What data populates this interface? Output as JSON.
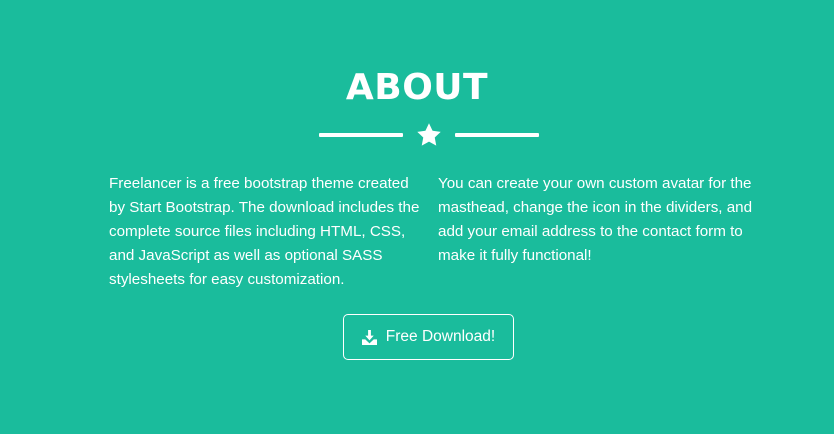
{
  "about": {
    "title": "ABOUT",
    "divider_icon": "star-icon",
    "column_left": "Freelancer is a free bootstrap theme created by Start Bootstrap. The download includes the complete source files including HTML, CSS, and JavaScript as well as optional SASS stylesheets for easy customization.",
    "column_right": "You can create your own custom avatar for the masthead, change the icon in the dividers, and add your email address to the contact form to make it fully functional!",
    "download_button": {
      "label": "Free Download!",
      "icon": "download-icon"
    }
  },
  "colors": {
    "background": "#1abc9c",
    "foreground": "#ffffff"
  }
}
